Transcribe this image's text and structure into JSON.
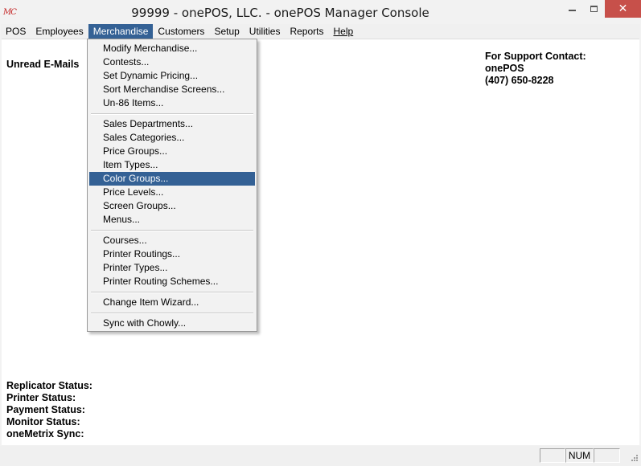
{
  "window": {
    "title": "99999 - onePOS, LLC. - onePOS Manager Console",
    "app_icon_text": "MC",
    "close_glyph": "✕"
  },
  "menubar": {
    "items": [
      {
        "label": "POS"
      },
      {
        "label": "Employees"
      },
      {
        "label": "Merchandise"
      },
      {
        "label": "Customers"
      },
      {
        "label": "Setup"
      },
      {
        "label": "Utilities"
      },
      {
        "label": "Reports"
      },
      {
        "label": "Help"
      }
    ]
  },
  "merchandise_menu": {
    "items": [
      "Modify Merchandise...",
      "Contests...",
      "Set Dynamic Pricing...",
      "Sort Merchandise Screens...",
      "Un-86 Items...",
      "Sales Departments...",
      "Sales Categories...",
      "Price Groups...",
      "Item Types...",
      "Color Groups...",
      "Price Levels...",
      "Screen Groups...",
      "Menus...",
      "Courses...",
      "Printer Routings...",
      "Printer Types...",
      "Printer Routing Schemes...",
      "Change Item Wizard...",
      "Sync with Chowly..."
    ],
    "highlighted": "Color Groups..."
  },
  "main": {
    "unread_emails": "Unread E-Mails",
    "support": {
      "heading": "For Support Contact:",
      "company": "onePOS",
      "phone": "(407) 650-8228"
    },
    "status_labels": [
      "Replicator Status:",
      "Printer Status:",
      "Payment Status:",
      "Monitor Status:",
      "oneMetrix Sync:"
    ]
  },
  "statusbar": {
    "panes": [
      "",
      "NUM",
      ""
    ]
  },
  "colors": {
    "highlight": "#346195",
    "close_button": "#c7504a",
    "app_icon": "#c21f1f"
  }
}
